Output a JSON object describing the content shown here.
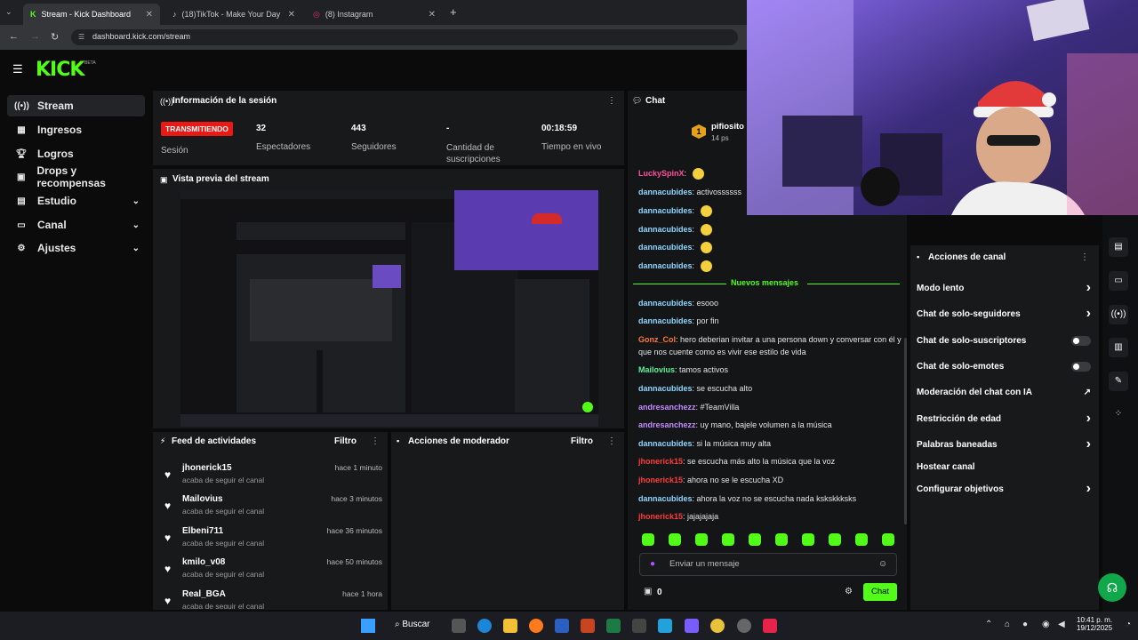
{
  "browser": {
    "tabs": [
      {
        "label": "Stream - Kick Dashboard"
      },
      {
        "label": "(18)TikTok - Make Your Day"
      },
      {
        "label": "(8) Instagram"
      }
    ],
    "url": "dashboard.kick.com/stream"
  },
  "app": {
    "logo": "KICK",
    "beta": "BETA"
  },
  "sidebar": {
    "items": [
      {
        "label": "Stream",
        "icon": "stream-icon"
      },
      {
        "label": "Ingresos",
        "icon": "revenue-icon"
      },
      {
        "label": "Logros",
        "icon": "trophy-icon"
      },
      {
        "label": "Drops y recompensas",
        "icon": "gift-icon"
      },
      {
        "label": "Estudio",
        "icon": "studio-icon"
      },
      {
        "label": "Canal",
        "icon": "channel-icon"
      },
      {
        "label": "Ajustes",
        "icon": "gear-icon"
      }
    ]
  },
  "session": {
    "title": "Información de la sesión",
    "status": "TRANSMITIENDO",
    "session_label": "Sesión",
    "stats": [
      {
        "value": "32",
        "label": "Espectadores"
      },
      {
        "value": "443",
        "label": "Seguidores"
      },
      {
        "value": "-",
        "label": "Cantidad de suscripciones"
      },
      {
        "value": "00:18:59",
        "label": "Tiempo en vivo"
      }
    ]
  },
  "preview": {
    "title": "Vista previa del stream"
  },
  "feed": {
    "title": "Feed de actividades",
    "filter": "Filtro",
    "items": [
      {
        "name": "jhonerick15",
        "action": "acaba de seguir el canal",
        "time": "hace 1 minuto"
      },
      {
        "name": "Mailovius",
        "action": "acaba de seguir el canal",
        "time": "hace 3 minutos"
      },
      {
        "name": "Elbeni711",
        "action": "acaba de seguir el canal",
        "time": "hace 36 minutos"
      },
      {
        "name": "kmilo_v08",
        "action": "acaba de seguir el canal",
        "time": "hace 50 minutos"
      },
      {
        "name": "Real_BGA",
        "action": "acaba de seguir el canal",
        "time": "hace 1 hora"
      }
    ]
  },
  "moderator": {
    "title": "Acciones de moderador",
    "filter": "Filtro"
  },
  "chat": {
    "title": "Chat",
    "top_user": {
      "rank": "1",
      "name": "pifiosito",
      "count": "14 ps"
    },
    "messages_old": [
      {
        "user": "LuckySpinX",
        "text": "",
        "color": "#ff4fa0"
      },
      {
        "user": "dannacubides",
        "text": "activossssss",
        "color": "#8fd7ff"
      },
      {
        "user": "dannacubides",
        "text": "",
        "color": "#8fd7ff"
      },
      {
        "user": "dannacubides",
        "text": "",
        "color": "#8fd7ff"
      },
      {
        "user": "dannacubides",
        "text": "",
        "color": "#8fd7ff"
      },
      {
        "user": "dannacubides",
        "text": "",
        "color": "#8fd7ff"
      }
    ],
    "new_label": "Nuevos mensajes",
    "messages_new": [
      {
        "user": "dannacubides",
        "text": "esooo",
        "color": "#8fd7ff"
      },
      {
        "user": "dannacubides",
        "text": "por fin",
        "color": "#8fd7ff"
      },
      {
        "user": "Gonz_Col",
        "text": "hero deberian invitar a una persona down y conversar con él y que nos cuente como es vivir ese estilo de vida",
        "color": "#ff7a3d"
      },
      {
        "user": "Mailovius",
        "text": "tamos activos",
        "color": "#5cf29a"
      },
      {
        "user": "dannacubides",
        "text": "se escucha alto",
        "color": "#8fd7ff"
      },
      {
        "user": "andresanchezz",
        "text": "#TeamVilla",
        "color": "#c58bff"
      },
      {
        "user": "andresanchezz",
        "text": "uy mano, bajele volumen a la música",
        "color": "#c58bff"
      },
      {
        "user": "dannacubides",
        "text": "si la música muy alta",
        "color": "#8fd7ff"
      },
      {
        "user": "jhonerick15",
        "text": "se escucha más alto la música que la voz",
        "color": "#ff3b3b"
      },
      {
        "user": "jhonerick15",
        "text": "ahora no se le escucha XD",
        "color": "#ff3b3b"
      },
      {
        "user": "dannacubides",
        "text": "ahora la voz no se escucha nada kskskkksks",
        "color": "#8fd7ff"
      },
      {
        "user": "jhonerick15",
        "text": "jajajajaja",
        "color": "#ff3b3b"
      }
    ],
    "input_placeholder": "Enviar un mensaje",
    "points": "0",
    "send_label": "Chat"
  },
  "channel_actions": {
    "title": "Acciones de canal",
    "items": [
      {
        "label": "Modo lento",
        "control": "chevron"
      },
      {
        "label": "Chat de solo-seguidores",
        "control": "chevron"
      },
      {
        "label": "Chat de solo-suscriptores",
        "control": "toggle"
      },
      {
        "label": "Chat de solo-emotes",
        "control": "toggle"
      },
      {
        "label": "Moderación del chat con IA",
        "control": "external"
      },
      {
        "label": "Restricción de edad",
        "control": "chevron"
      },
      {
        "label": "Palabras baneadas",
        "control": "chevron"
      },
      {
        "label": "Hostear canal",
        "control": "none"
      },
      {
        "label": "Configurar objetivos",
        "control": "chevron"
      }
    ]
  },
  "taskbar": {
    "search": "Buscar",
    "time": "10:41 p. m.",
    "date": "19/12/2025"
  },
  "colors": {
    "accent": "#53fc18",
    "live": "#e91916"
  }
}
